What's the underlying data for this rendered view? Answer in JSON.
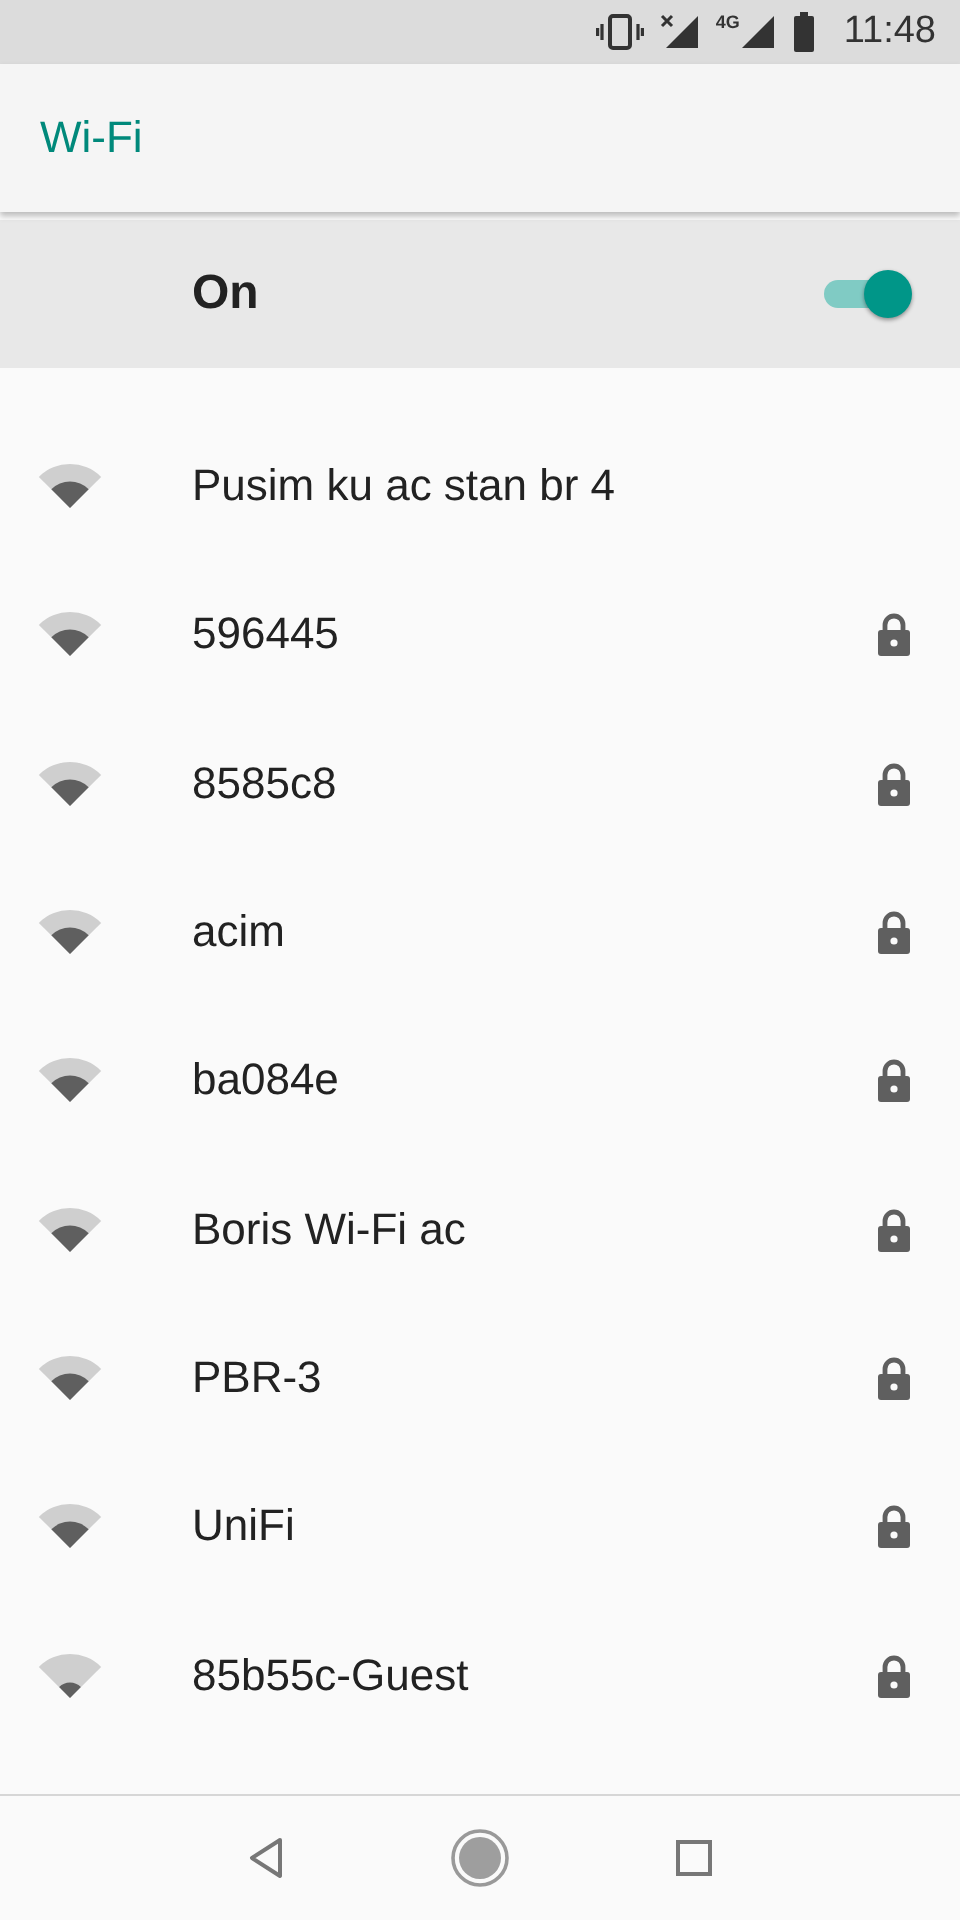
{
  "status_bar": {
    "network_type": "4G",
    "time": "11:48"
  },
  "app_bar": {
    "title": "Wi-Fi"
  },
  "master_switch": {
    "label": "On",
    "on": true
  },
  "networks": [
    {
      "name": "Pusim ku ac stan br 4",
      "kind": "medium",
      "secured": false
    },
    {
      "name": "596445",
      "kind": "medium",
      "secured": true
    },
    {
      "name": "8585c8",
      "kind": "medium",
      "secured": true
    },
    {
      "name": "acim",
      "kind": "medium",
      "secured": true
    },
    {
      "name": "ba084e",
      "kind": "medium",
      "secured": true
    },
    {
      "name": "Boris Wi-Fi ac",
      "kind": "medium",
      "secured": true
    },
    {
      "name": "PBR-3",
      "kind": "medium",
      "secured": true
    },
    {
      "name": "UniFi",
      "kind": "medium",
      "secured": true
    },
    {
      "name": "85b55c-Guest",
      "kind": "weak",
      "secured": true
    }
  ]
}
